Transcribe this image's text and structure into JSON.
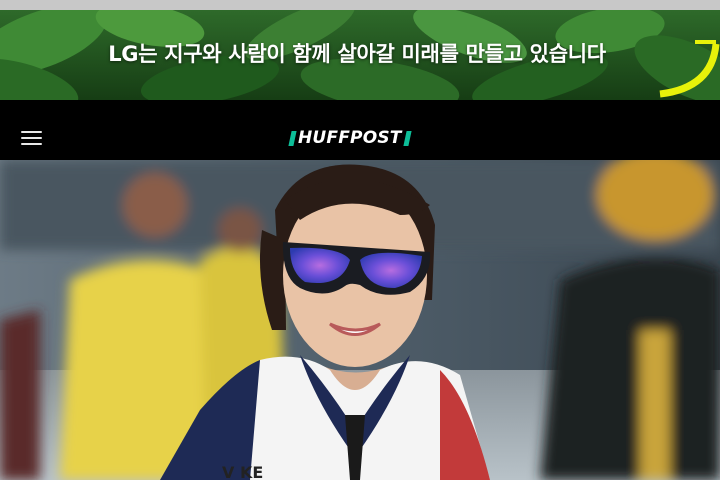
{
  "ad": {
    "headline": "LG는 지구와 사람이 함께 살아갈 미래를 만들고 있습니다",
    "accent_color": "#e8f20a"
  },
  "header": {
    "logo_text": "HUFFPOST",
    "logo_accent_color": "#0dbe98",
    "menu_icon": "hamburger-menu-icon"
  },
  "hero": {
    "image_subject": "smiling speed skater wearing mirrored sport sunglasses and a white, navy and red racing suit"
  }
}
